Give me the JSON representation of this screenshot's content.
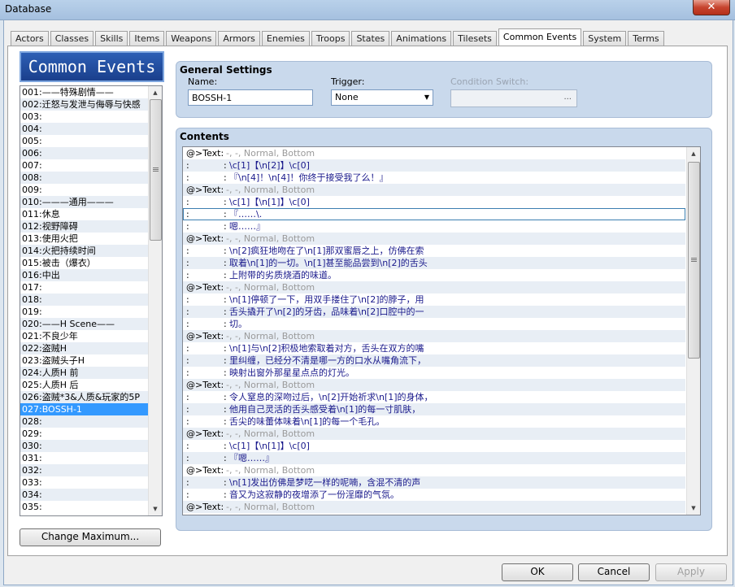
{
  "window": {
    "title": "Database",
    "close_symbol": "✕"
  },
  "tabs": [
    "Actors",
    "Classes",
    "Skills",
    "Items",
    "Weapons",
    "Armors",
    "Enemies",
    "Troops",
    "States",
    "Animations",
    "Tilesets",
    "Common Events",
    "System",
    "Terms"
  ],
  "active_tab_index": 11,
  "sidebar": {
    "title": "Common Events",
    "items": [
      "001:——特殊剧情——",
      "002:迁怒与发泄与侮辱与快感",
      "003:",
      "004:",
      "005:",
      "006:",
      "007:",
      "008:",
      "009:",
      "010:———通用———",
      "011:休息",
      "012:视野障碍",
      "013:使用火把",
      "014:火把持续时间",
      "015:被击（爆衣）",
      "016:中出",
      "017:",
      "018:",
      "019:",
      "020:——H Scene——",
      "021:不良少年",
      "022:盗贼H",
      "023:盗贼头子H",
      "024:人质H 前",
      "025:人质H 后",
      "026:盗贼*3&人质&玩家的5P",
      "027:BOSSH-1",
      "028:",
      "029:",
      "030:",
      "031:",
      "032:",
      "033:",
      "034:",
      "035:"
    ],
    "selected_index": 26,
    "change_max_label": "Change Maximum..."
  },
  "general": {
    "title": "General Settings",
    "name_label": "Name:",
    "name_value": "BOSSH-1",
    "trigger_label": "Trigger:",
    "trigger_value": "None",
    "condition_label": "Condition Switch:",
    "condition_dots": "..."
  },
  "contents": {
    "title": "Contents",
    "highlight_index": 5,
    "lines": [
      {
        "k": "text",
        "p": "@>Text:",
        "m": "-, -, Normal, Bottom"
      },
      {
        "k": "cont",
        "t": "\\c[1]【\\n[2]】\\c[0]"
      },
      {
        "k": "cont",
        "t": "『\\n[4]！\\n[4]！你终于接受我了么！』"
      },
      {
        "k": "text",
        "p": "@>Text:",
        "m": "-, -, Normal, Bottom"
      },
      {
        "k": "cont",
        "t": "\\c[1]【\\n[1]】\\c[0]"
      },
      {
        "k": "cont",
        "t": "『……\\."
      },
      {
        "k": "cont",
        "t": "嗯……』"
      },
      {
        "k": "text",
        "p": "@>Text:",
        "m": "-, -, Normal, Bottom"
      },
      {
        "k": "cont",
        "t": "\\n[2]疯狂地吻在了\\n[1]那双蜜唇之上，仿佛在索"
      },
      {
        "k": "cont",
        "t": "取着\\n[1]的一切。\\n[1]甚至能品尝到\\n[2]的舌头"
      },
      {
        "k": "cont",
        "t": "上附带的劣质烧酒的味道。"
      },
      {
        "k": "text",
        "p": "@>Text:",
        "m": "-, -, Normal, Bottom"
      },
      {
        "k": "cont",
        "t": "\\n[1]停顿了一下，用双手搂住了\\n[2]的脖子，用"
      },
      {
        "k": "cont",
        "t": "舌头撬开了\\n[2]的牙齿，品味着\\n[2]口腔中的一"
      },
      {
        "k": "cont",
        "t": "切。"
      },
      {
        "k": "text",
        "p": "@>Text:",
        "m": "-, -, Normal, Bottom"
      },
      {
        "k": "cont",
        "t": "\\n[1]与\\n[2]积极地索取着对方，舌头在双方的嘴"
      },
      {
        "k": "cont",
        "t": "里纠缠，已经分不清是哪一方的口水从嘴角流下，"
      },
      {
        "k": "cont",
        "t": "映射出窗外那星星点点的灯光。"
      },
      {
        "k": "text",
        "p": "@>Text:",
        "m": "-, -, Normal, Bottom"
      },
      {
        "k": "cont",
        "t": "令人窒息的深吻过后，\\n[2]开始祈求\\n[1]的身体，"
      },
      {
        "k": "cont",
        "t": "他用自己灵活的舌头感受着\\n[1]的每一寸肌肤，"
      },
      {
        "k": "cont",
        "t": "舌尖的味蕾体味着\\n[1]的每一个毛孔。"
      },
      {
        "k": "text",
        "p": "@>Text:",
        "m": "-, -, Normal, Bottom"
      },
      {
        "k": "cont",
        "t": "\\c[1]【\\n[1]】\\c[0]"
      },
      {
        "k": "cont",
        "t": "『嗯……』"
      },
      {
        "k": "text",
        "p": "@>Text:",
        "m": "-, -, Normal, Bottom"
      },
      {
        "k": "cont",
        "t": "\\n[1]发出仿佛是梦呓一样的呢喃，含混不清的声"
      },
      {
        "k": "cont",
        "t": "音又为这寂静的夜增添了一份淫靡的气氛。"
      },
      {
        "k": "text",
        "p": "@>Text:",
        "m": "-, -, Normal, Bottom"
      }
    ],
    "colon": ":"
  },
  "buttons": {
    "ok": "OK",
    "cancel": "Cancel",
    "apply": "Apply"
  },
  "colors": {
    "selection": "#3399ff",
    "panel": "#c9d9ec",
    "title_bar": "#2d5fb5",
    "text_blue": "#1a1a8c",
    "meta_gray": "#9a9a9a"
  },
  "icons": {
    "scroll_up": "▲",
    "scroll_down": "▼",
    "dropdown": "▼"
  }
}
